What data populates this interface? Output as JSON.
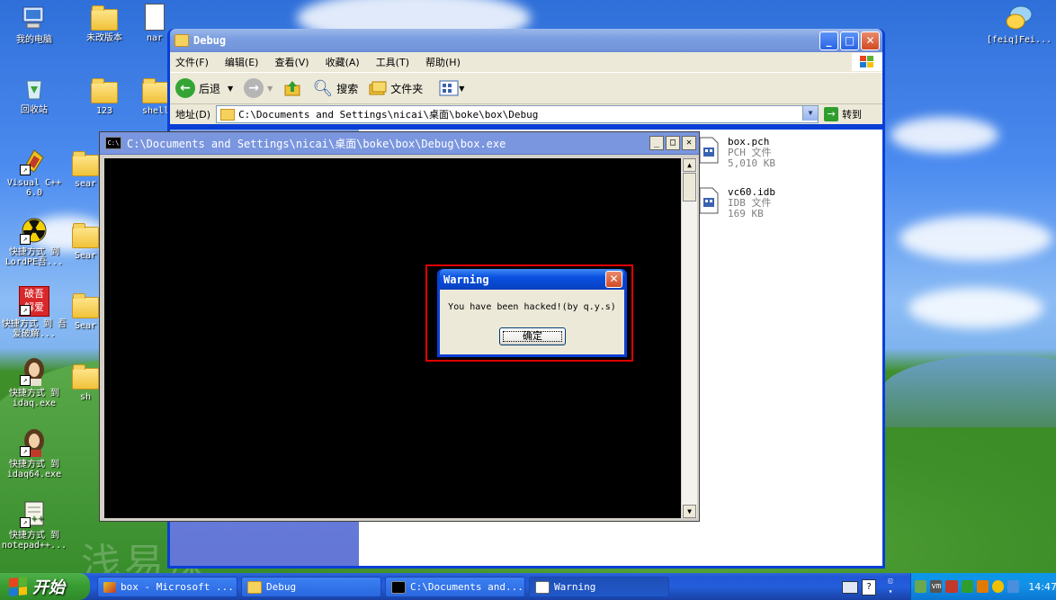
{
  "desktop_icons": [
    {
      "label": "我的电脑"
    },
    {
      "label": "未改版本"
    },
    {
      "label": "nar"
    },
    {
      "label": "回收站"
    },
    {
      "label": "123"
    },
    {
      "label": "shell"
    },
    {
      "label": "Visual C++ 6.0"
    },
    {
      "label": "sear"
    },
    {
      "label": "快捷方式 到 LordPE吾..."
    },
    {
      "label": "Sear"
    },
    {
      "label": "快捷方式 到 吾爱破解..."
    },
    {
      "label": "Sear"
    },
    {
      "label": "快捷方式 到 idaq.exe"
    },
    {
      "label": "sh"
    },
    {
      "label": "快捷方式 到 idaq64.exe"
    },
    {
      "label": "快捷方式 到 notepad++..."
    },
    {
      "label": "[feiq]Fei..."
    }
  ],
  "watermark": "浅易深",
  "explorer": {
    "title": "Debug",
    "menu": [
      "文件(F)",
      "编辑(E)",
      "查看(V)",
      "收藏(A)",
      "工具(T)",
      "帮助(H)"
    ],
    "toolbar": {
      "back": "后退",
      "search": "搜索",
      "folders": "文件夹"
    },
    "address_label": "地址(D)",
    "address_value": "C:\\Documents and Settings\\nicai\\桌面\\boke\\box\\Debug",
    "go_label": "转到",
    "files": [
      {
        "name": "box.pch",
        "type": "PCH 文件",
        "size": "5,010 KB"
      },
      {
        "name": "vc60.idb",
        "type": "IDB 文件",
        "size": "169 KB"
      }
    ]
  },
  "console": {
    "title": "C:\\Documents and Settings\\nicai\\桌面\\boke\\box\\Debug\\box.exe",
    "icon_text": "C:\\"
  },
  "dialog": {
    "title": "Warning",
    "message": "You have been hacked!(by q.y.s)",
    "ok_label": "确定"
  },
  "taskbar": {
    "start_label": "开始",
    "tasks": [
      {
        "label": "box - Microsoft ..."
      },
      {
        "label": "Debug"
      },
      {
        "label": "C:\\Documents and..."
      },
      {
        "label": "Warning"
      }
    ],
    "clock": "14:47"
  },
  "colors": {
    "highlight_box": "#e00000",
    "console_bg": "#000000",
    "xp_blue": "#0a3fd6"
  }
}
